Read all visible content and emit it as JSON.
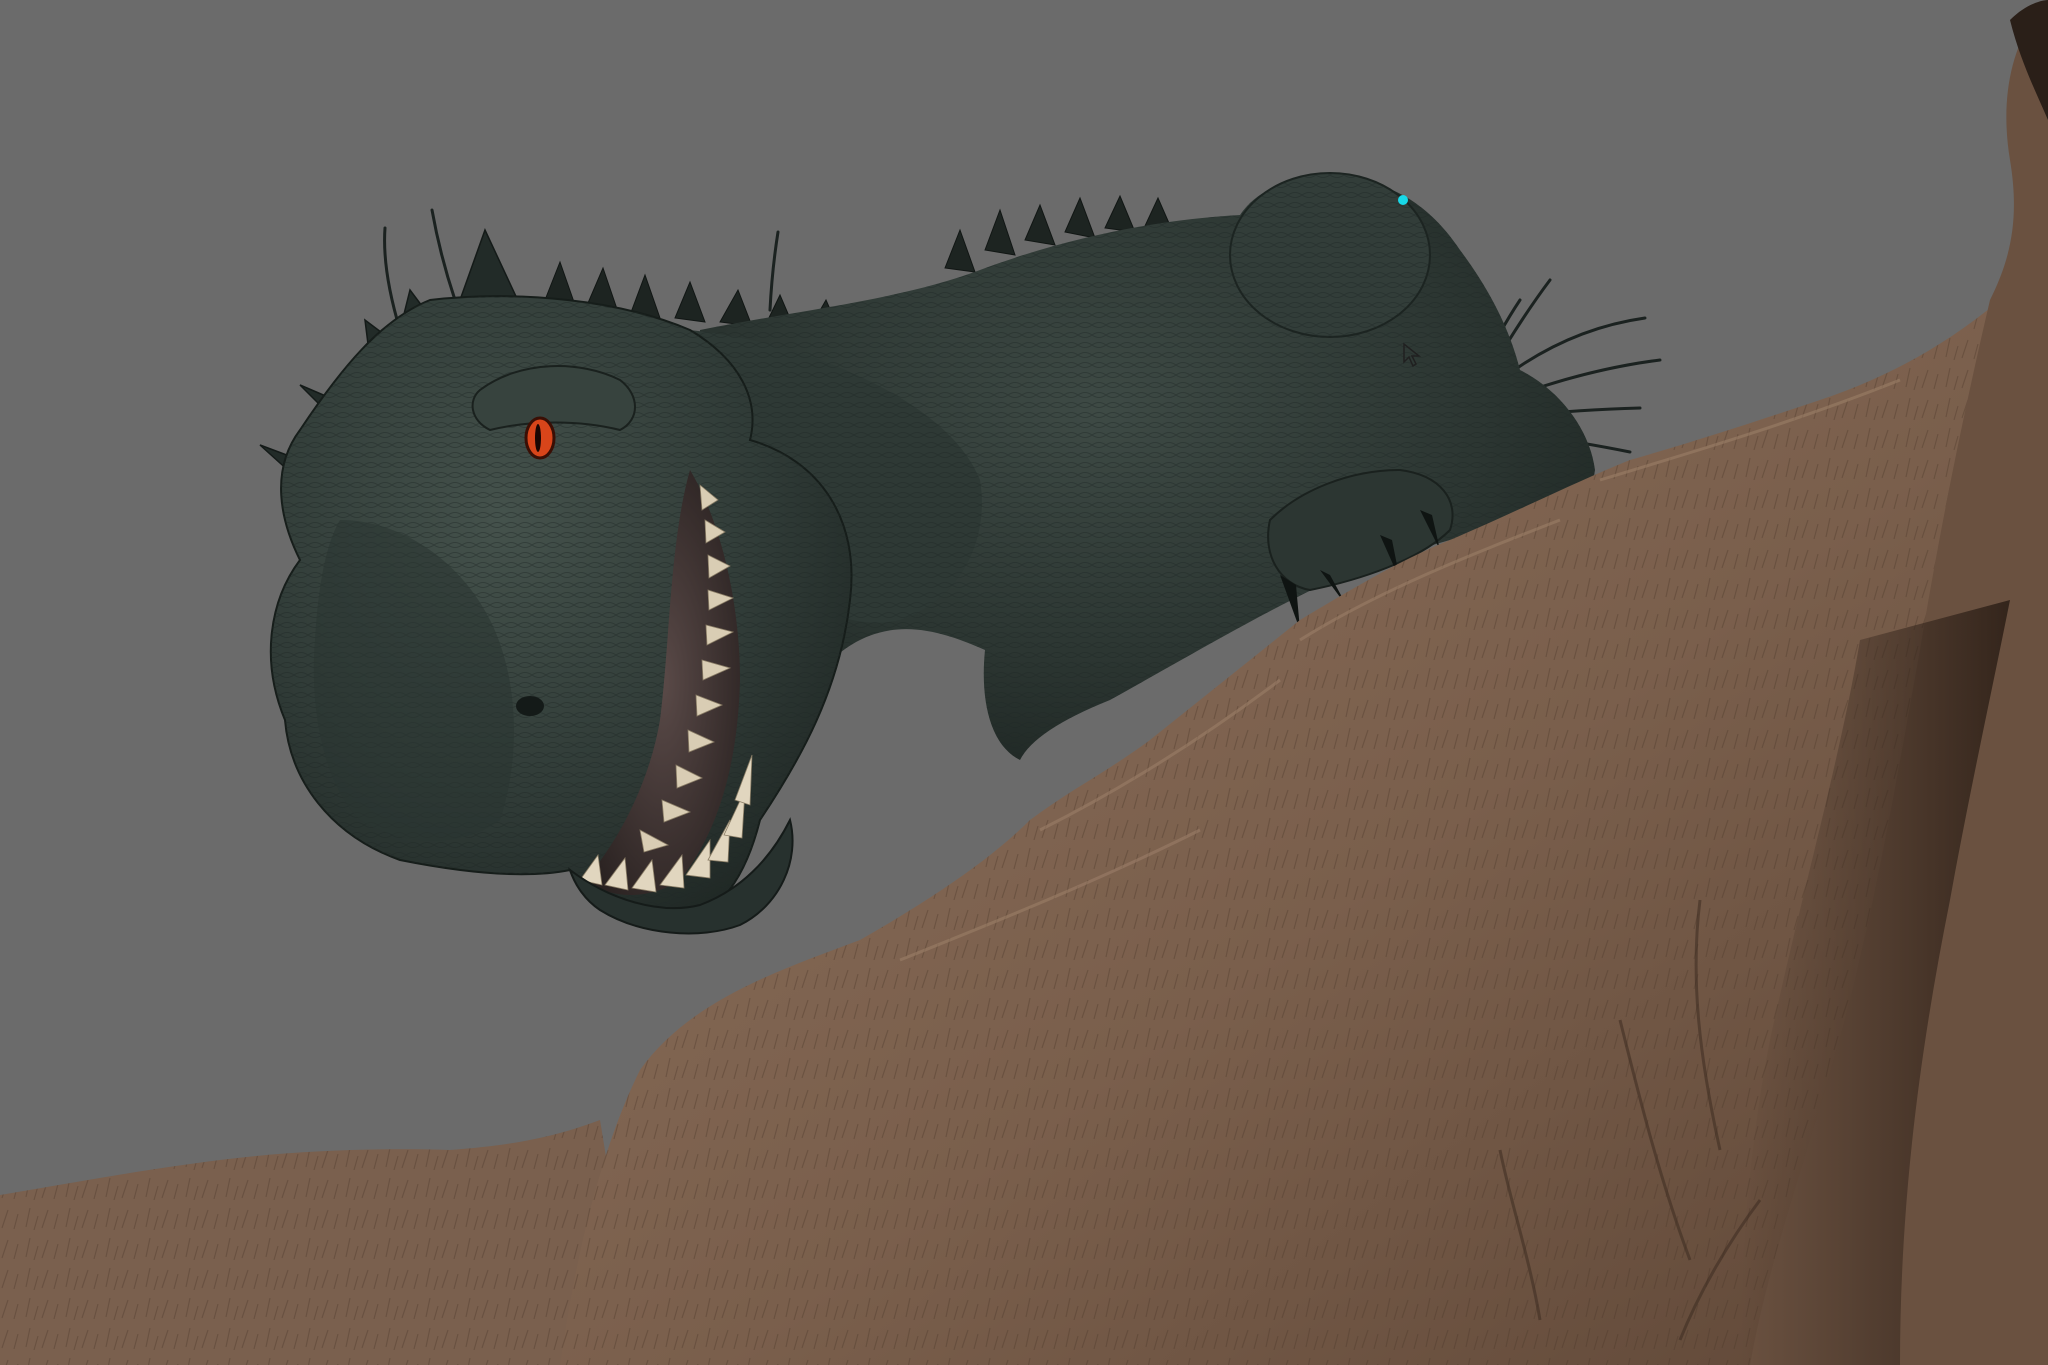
{
  "viewport": {
    "background_color": "#6b6b6b"
  },
  "scene": {
    "objects": [
      {
        "name": "creature-model",
        "color": "#2f3a36"
      },
      {
        "name": "rock-terrain",
        "color": "#7d624f"
      }
    ],
    "eye_color": "#d8451a",
    "teeth_color": "#d9cdb4",
    "marker_color": "#18d8e8",
    "cursor_icon": "arrow-cursor-icon"
  }
}
